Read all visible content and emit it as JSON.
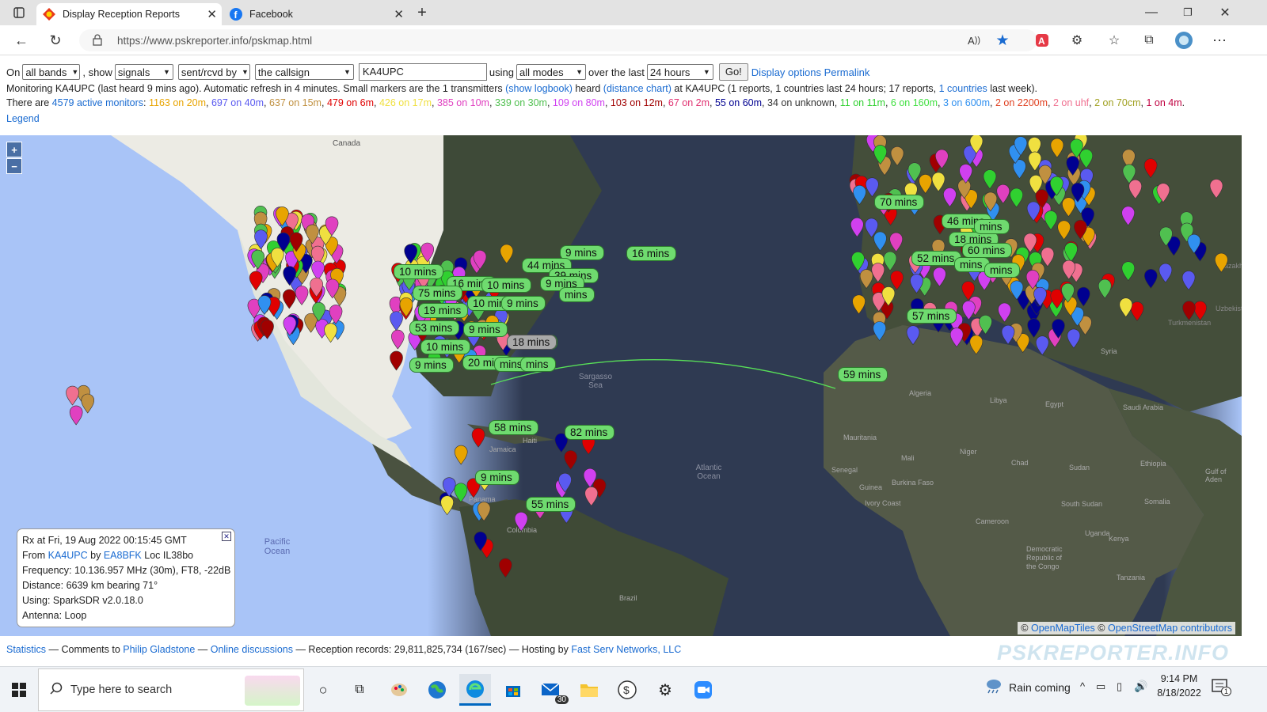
{
  "browser": {
    "tabs": [
      {
        "title": "Display Reception Reports",
        "icon": "pskreporter-favicon-icon"
      },
      {
        "title": "Facebook",
        "icon": "facebook-icon"
      }
    ],
    "url": "https://www.pskreporter.info/pskmap.html",
    "window_controls": [
      "minimize-icon",
      "restore-icon",
      "close-icon"
    ]
  },
  "controls": {
    "on_label": "On",
    "bands": "all bands",
    "show_label": ", show",
    "show": "signals",
    "direction": "sent/rcvd by",
    "target": "the callsign",
    "callsign": "KA4UPC",
    "using_label": "using",
    "modes": "all modes",
    "over_label": "over the last",
    "period": "24 hours",
    "go": "Go!",
    "display_options": "Display options",
    "permalink": "Permalink"
  },
  "monitoring": {
    "a": "Monitoring KA4UPC (last heard 9 mins ago). Automatic refresh in 4 minutes. Small markers are the 1 transmitters ",
    "show_logbook": "(show logbook)",
    "b": " heard ",
    "distance_chart": "(distance chart)",
    "c": " at KA4UPC (1 reports, 1 countries last 24 hours; 17 reports, ",
    "countries": "1 countries",
    "d": " last week)."
  },
  "monitors": {
    "prefix": "There are ",
    "active": "4579 active monitors",
    "colon": ": ",
    "bands": [
      {
        "text": "1163 on 20m",
        "color": "#e8a400"
      },
      {
        "text": "697 on 40m",
        "color": "#5a5af0"
      },
      {
        "text": "637 on 15m",
        "color": "#c09040"
      },
      {
        "text": "479 on 6m",
        "color": "#e00000"
      },
      {
        "text": "426 on 17m",
        "color": "#f0e040"
      },
      {
        "text": "385 on 10m",
        "color": "#e040c0"
      },
      {
        "text": "339 on 30m",
        "color": "#50c050"
      },
      {
        "text": "109 on 80m",
        "color": "#d040f0"
      },
      {
        "text": "103 on 12m",
        "color": "#a00000"
      },
      {
        "text": "67 on 2m",
        "color": "#e03070"
      },
      {
        "text": "55 on 60m",
        "color": "#000090"
      },
      {
        "text": "34 on unknown",
        "color": "#333333"
      },
      {
        "text": "11 on 11m",
        "color": "#30d030"
      },
      {
        "text": "6 on 160m",
        "color": "#40e040"
      },
      {
        "text": "3 on 600m",
        "color": "#3090f0"
      },
      {
        "text": "2 on 2200m",
        "color": "#e04020"
      },
      {
        "text": "2 on uhf",
        "color": "#f07090"
      },
      {
        "text": "2 on 70cm",
        "color": "#a0a020"
      },
      {
        "text": "1 on 4m",
        "color": "#c00040"
      }
    ],
    "legend": "Legend"
  },
  "map": {
    "zoom_in": "+",
    "zoom_out": "−",
    "labels": [
      "Canada",
      "Sargasso Sea",
      "Atlantic Ocean",
      "Pacific Ocean",
      "Jamaica",
      "Colombia",
      "Brazil",
      "Algeria",
      "Libya",
      "Egypt",
      "Mali",
      "Niger",
      "Chad",
      "Sudan",
      "Mauritania",
      "Senegal",
      "Ivory Coast",
      "Burkina Faso",
      "Guinea",
      "South Sudan",
      "Ethiopia",
      "Somalia",
      "Kenya",
      "Uganda",
      "Cameroon",
      "Democratic Republic of the Congo",
      "Tanzania",
      "Syria",
      "Saudi Arabia",
      "Kazakhstan",
      "Uzbekistan",
      "Turkmenistan",
      "Gulf of Aden",
      "Panama",
      "Haiti"
    ],
    "time_markers": [
      "10 mins",
      "16 mins",
      "9 mins",
      "44 mins",
      "39 mins",
      "16 mins",
      "10 mins",
      "9 mins",
      "75 mins",
      "19 mins",
      "10 mins",
      "9 mins",
      "53 mins",
      "9 mins",
      "18 mins",
      "10 mins",
      "9 mins",
      "20 mins",
      "mins",
      "58 mins",
      "82 mins",
      "9 mins",
      "55 mins",
      "59 mins",
      "70 mins",
      "46 mins",
      "18 mins",
      "60 mins",
      "52 mins",
      "mins",
      "57 mins",
      "mins",
      "mins",
      "mins",
      "mins"
    ],
    "attribution_a": "© ",
    "openmaptiles": "OpenMapTiles",
    "attribution_b": " © ",
    "openstreetmap": "OpenStreetMap contributors"
  },
  "popup": {
    "rx": "Rx at Fri, 19 Aug 2022 00:15:45 GMT",
    "from_label": "From ",
    "from_call": "KA4UPC",
    "by_label": " by ",
    "by_call": "EA8BFK",
    "loc": " Loc IL38bo",
    "frequency": "Frequency: 10.136.957 MHz (30m), FT8, -22dB",
    "distance": "Distance: 6639 km bearing 71°",
    "using": "Using: SparkSDR v2.0.18.0",
    "antenna": "Antenna: Loop"
  },
  "footer": {
    "statistics": "Statistics",
    "a": " — Comments to ",
    "gladstone": "Philip Gladstone",
    "b": " — ",
    "discussions": "Online discussions",
    "c": " — Reception records: 29,811,825,734 (167/sec) — Hosting by ",
    "fastserv": "Fast Serv Networks, LLC",
    "brand": "PSKREPORTER.INFO"
  },
  "taskbar": {
    "search_placeholder": "Type here to search",
    "weather": "Rain coming",
    "time": "9:14 PM",
    "date": "8/18/2022",
    "mail_badge": "30",
    "notif_badge": "1"
  }
}
